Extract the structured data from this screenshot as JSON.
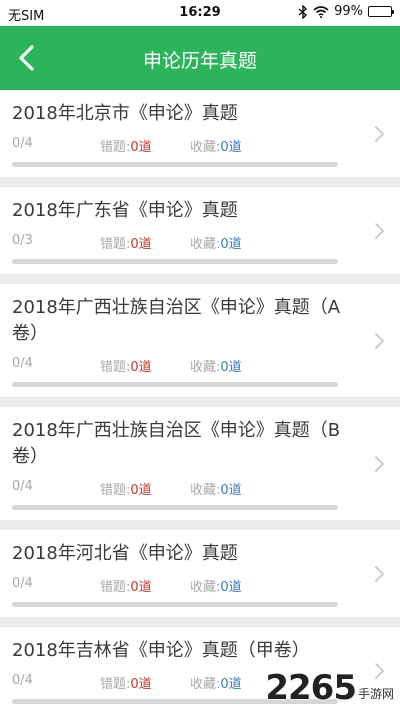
{
  "status_bar": {
    "carrier": "无SIM",
    "time": "16:29",
    "battery_text": "99%",
    "battery_level": 0.99
  },
  "nav": {
    "title": "申论历年真题"
  },
  "labels": {
    "wrong": "错题:",
    "fav": "收藏:"
  },
  "items": [
    {
      "name": "2018年北京市《申论》真题",
      "count": "0/4",
      "wrong_value": "0道",
      "fav_value": "0道",
      "progress": 0
    },
    {
      "name": "2018年广东省《申论》真题",
      "count": "0/3",
      "wrong_value": "0道",
      "fav_value": "0道",
      "progress": 0
    },
    {
      "name": "2018年广西壮族自治区《申论》真题（A卷）",
      "count": "0/4",
      "wrong_value": "0道",
      "fav_value": "0道",
      "progress": 0
    },
    {
      "name": "2018年广西壮族自治区《申论》真题（B卷）",
      "count": "0/4",
      "wrong_value": "0道",
      "fav_value": "0道",
      "progress": 0
    },
    {
      "name": "2018年河北省《申论》真题",
      "count": "0/4",
      "wrong_value": "0道",
      "fav_value": "0道",
      "progress": 0
    },
    {
      "name": "2018年吉林省《申论》真题（甲卷）",
      "count": "0/4",
      "wrong_value": "0道",
      "fav_value": "0道",
      "progress": 0
    }
  ],
  "watermark": {
    "number": "2265",
    "suffix": "手游网"
  },
  "colors": {
    "accent": "#2cb45d",
    "wrong": "#c0392b",
    "fav": "#3a7bbd"
  },
  "icons": {
    "back": "chevron-left-icon",
    "row": "chevron-right-icon",
    "wifi": "wifi-icon",
    "bluetooth": "bluetooth-icon",
    "battery": "battery-icon"
  }
}
